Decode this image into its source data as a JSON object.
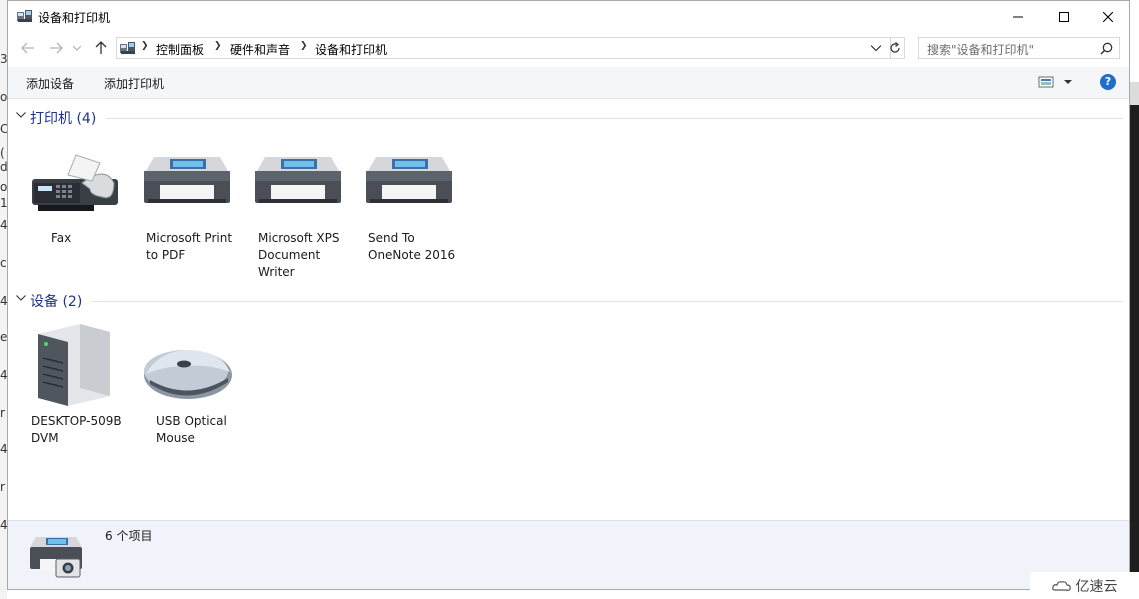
{
  "window": {
    "title": "设备和打印机"
  },
  "address": {
    "crumbs": [
      "控制面板",
      "硬件和声音",
      "设备和打印机"
    ]
  },
  "search": {
    "placeholder": "搜索\"设备和打印机\""
  },
  "toolbar": {
    "add_device": "添加设备",
    "add_printer": "添加打印机"
  },
  "groups": {
    "printers": {
      "title": "打印机 (4)",
      "items": [
        {
          "label": "Fax",
          "icon": "fax-icon"
        },
        {
          "label": "Microsoft Print\nto PDF",
          "icon": "printer-icon"
        },
        {
          "label": "Microsoft XPS\nDocument\nWriter",
          "icon": "printer-icon"
        },
        {
          "label": "Send To\nOneNote 2016",
          "icon": "printer-icon"
        }
      ]
    },
    "devices": {
      "title": "设备 (2)",
      "items": [
        {
          "label": "DESKTOP-509B\nDVM",
          "icon": "computer-icon"
        },
        {
          "label": "USB Optical\nMouse",
          "icon": "mouse-icon"
        }
      ]
    }
  },
  "details": {
    "count": "6 个项目"
  },
  "background": {
    "left_chars": [
      "3",
      "o",
      "C",
      "(",
      "d",
      "o",
      "1",
      "4",
      "c",
      "4",
      "e",
      "4",
      "r",
      "4",
      "r",
      "4"
    ]
  },
  "watermark": {
    "text": "亿速云"
  },
  "colors": {
    "group_title": "#1e3287",
    "help": "#1e6fc8",
    "details_bg": "#f0f4fa"
  }
}
